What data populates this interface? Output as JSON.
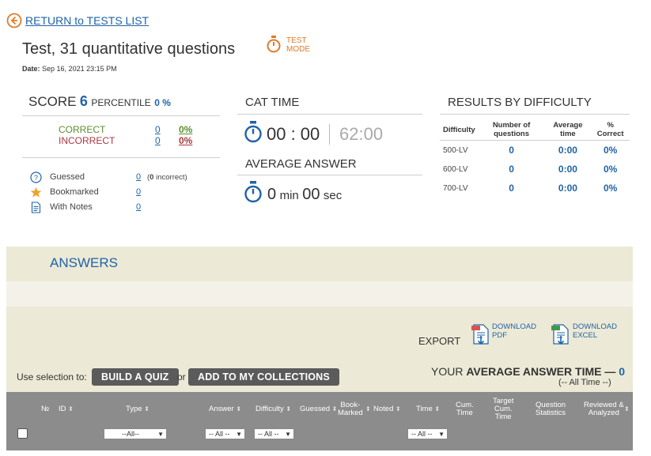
{
  "nav": {
    "return_label": "RETURN to TESTS LIST"
  },
  "header": {
    "title": "Test, 31 quantitative questions",
    "date_label": "Date:",
    "date_value": "Sep 16, 2021 23:15 PM",
    "mode_line1": "TEST",
    "mode_line2": "MODE"
  },
  "score": {
    "score_label": "SCORE",
    "score_value": "6",
    "percentile_label": "PERCENTILE",
    "percentile_value": "0 %",
    "correct_label": "CORRECT",
    "correct_count": "0",
    "correct_pct": "0%",
    "incorrect_label": "INCORRECT",
    "incorrect_count": "0",
    "incorrect_pct": "0%",
    "guessed_label": "Guessed",
    "guessed_value": "0",
    "guessed_extra_num": "0",
    "guessed_extra_text": " incorrect)",
    "bookmarked_label": "Bookmarked",
    "bookmarked_value": "0",
    "notes_label": "With Notes",
    "notes_value": "0"
  },
  "cat_time": {
    "label": "CAT TIME",
    "elapsed": "00 : 00",
    "limit": "62:00"
  },
  "average": {
    "label": "AVERAGE ANSWER",
    "min_value": "0",
    "min_unit": "min",
    "sec_value": "00",
    "sec_unit": "sec"
  },
  "difficulty": {
    "label": "RESULTS BY DIFFICULTY",
    "headers": [
      "Difficulty",
      "Number of questions",
      "Average time",
      "% Correct"
    ],
    "rows": [
      {
        "level": "500-LV",
        "count": "0",
        "time": "0:00",
        "pct": "0%"
      },
      {
        "level": "600-LV",
        "count": "0",
        "time": "0:00",
        "pct": "0%"
      },
      {
        "level": "700-LV",
        "count": "0",
        "time": "0:00",
        "pct": "0%"
      }
    ]
  },
  "answers": {
    "title": "ANSWERS"
  },
  "export": {
    "label": "EXPORT",
    "pdf_line1": "DOWNLOAD",
    "pdf_line2": "PDF",
    "excel_line1": "DOWNLOAD",
    "excel_line2": "EXCEL"
  },
  "selection": {
    "prefix": "Use selection to:",
    "build_quiz": "BUILD A QUIZ",
    "or": "or",
    "add_collections": "ADD TO MY COLLECTIONS"
  },
  "avg_answer_time": {
    "prefix": "YOUR",
    "label": "AVERAGE ANSWER TIME",
    "dash": "—",
    "value": "0",
    "sub": "(-- All Time --)"
  },
  "table": {
    "headers": {
      "no": "№",
      "id": "ID",
      "type": "Type",
      "answer": "Answer",
      "difficulty": "Difficulty",
      "guessed": "Guessed",
      "bookmarked_1": "Book-",
      "bookmarked_2": "Marked",
      "noted": "Noted",
      "time": "Time",
      "cum_1": "Cum.",
      "cum_2": "Time",
      "target_1": "Target",
      "target_2": "Cum.",
      "target_3": "Time",
      "qstats_1": "Question",
      "qstats_2": "Statistics",
      "reviewed_1": "Reviewed &",
      "reviewed_2": "Analyzed"
    },
    "filters": {
      "type": "--All--",
      "answer": "-- All --",
      "difficulty": "-- All --",
      "time": "-- All --"
    }
  },
  "colors": {
    "accent_blue": "#1f63a8",
    "orange": "#e07b2a",
    "beige": "#ece9d6",
    "table_header": "#8c8c8c"
  }
}
